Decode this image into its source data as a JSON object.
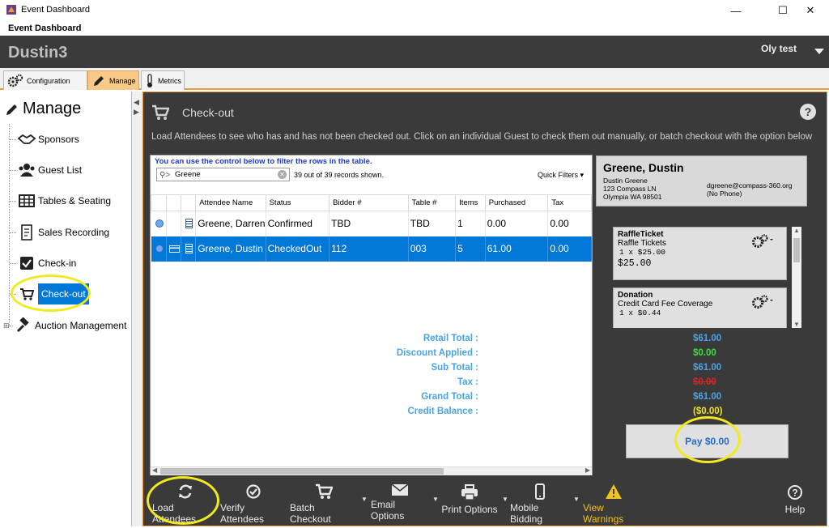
{
  "window": {
    "title": "Event Dashboard",
    "menu_title": "Event Dashboard"
  },
  "header": {
    "event_name": "Dustin3",
    "user": "Oly test"
  },
  "tabs": [
    {
      "label": "Configuration"
    },
    {
      "label": "Manage"
    },
    {
      "label": "Metrics"
    }
  ],
  "sidebar": {
    "heading": "Manage",
    "items": [
      {
        "label": "Sponsors"
      },
      {
        "label": "Guest List"
      },
      {
        "label": "Tables & Seating"
      },
      {
        "label": "Sales Recording"
      },
      {
        "label": "Check-in"
      },
      {
        "label": "Check-out"
      },
      {
        "label": "Auction Management"
      }
    ]
  },
  "main": {
    "title": "Check-out",
    "instructions": "Load Attendees to see who has and has not been checked out. Click on an individual Guest to check them out manually, or batch checkout with the option below",
    "help": "?"
  },
  "grid": {
    "filter_hint": "You can use the control below to filter the rows in the table.",
    "filter_value": "Greene",
    "records_shown": "39 out of 39 records shown.",
    "quick_filters": "Quick Filters",
    "columns": [
      "Attendee Name",
      "Status",
      "Bidder #",
      "Table #",
      "Items",
      "Purchased",
      "Tax"
    ],
    "rows": [
      {
        "name": "Greene, Darren",
        "status": "Confirmed",
        "bidder": "TBD",
        "table": "TBD",
        "items": "1",
        "purchased": "0.00",
        "tax": "0.00"
      },
      {
        "name": "Greene, Dustin",
        "status": "CheckedOut",
        "bidder": "112",
        "table": "003",
        "items": "5",
        "purchased": "61.00",
        "tax": "0.00"
      }
    ]
  },
  "guest": {
    "name": "Greene, Dustin",
    "address_name": "Dustin Greene",
    "street": "123 Compass LN",
    "city": "Olympia WA 98501",
    "email": "dgreene@compass-360.org",
    "phone": "(No Phone)"
  },
  "items": [
    {
      "name": "RaffleTicket",
      "desc": "Raffle Tickets",
      "qty": "1 x  $25.00",
      "amount": "$25.00"
    },
    {
      "name": "Donation",
      "desc": "Credit Card Fee Coverage",
      "qty": "1 x  $0.44",
      "amount": ""
    }
  ],
  "totals": {
    "retail_label": "Retail Total :",
    "retail": "$61.00",
    "discount_label": "Discount Applied :",
    "discount": "$0.00",
    "subtotal_label": "Sub Total :",
    "subtotal": "$61.00",
    "tax_label": "Tax :",
    "tax": "$0.00",
    "grand_label": "Grand Total :",
    "grand": "$61.00",
    "credit_label": "Credit Balance :",
    "credit": "($0.00)"
  },
  "pay_button": "Pay $0.00",
  "toolbar": {
    "load": "Load Attendees",
    "verify": "Verify Attendees",
    "batch": "Batch Checkout",
    "email": "Email Options",
    "print": "Print Options",
    "mobile": "Mobile Bidding",
    "warnings": "View Warnings",
    "help": "Help"
  },
  "colors": {
    "accent_orange": "#e99a3a",
    "selection_blue": "#0078d7",
    "total_blue": "#4aa3e6",
    "discount_green": "#2ee82e",
    "tax_red": "#e32020",
    "credit_yellow": "#f2e21d",
    "warning_yellow": "#f2c21d",
    "highlight_ring": "#f2ea1d"
  }
}
